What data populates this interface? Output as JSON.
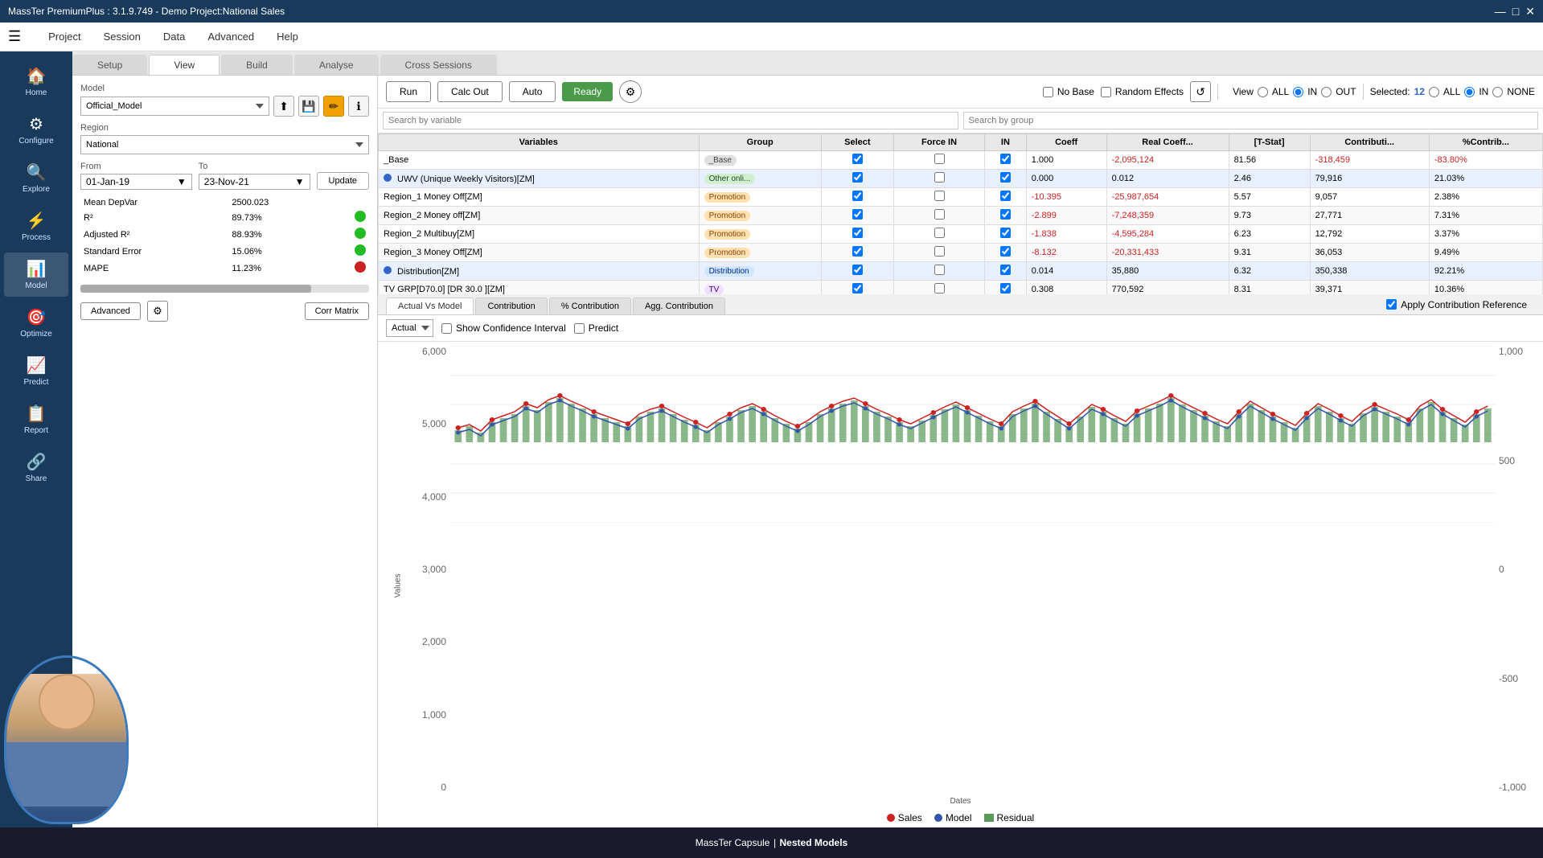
{
  "titlebar": {
    "title": "MassTer PremiumPlus : 3.1.9.749 - Demo Project:National Sales",
    "minimize": "—",
    "maximize": "□",
    "close": "✕"
  },
  "menubar": {
    "items": [
      "Project",
      "Session",
      "Data",
      "Advanced",
      "Help"
    ]
  },
  "tabs": {
    "items": [
      "Setup",
      "View",
      "Build",
      "Analyse",
      "Cross Sessions"
    ]
  },
  "sidebar": {
    "items": [
      {
        "label": "Home",
        "icon": "🏠"
      },
      {
        "label": "Configure",
        "icon": "⚙"
      },
      {
        "label": "Explore",
        "icon": "🔍"
      },
      {
        "label": "Process",
        "icon": "⚡"
      },
      {
        "label": "Model",
        "icon": "📊"
      },
      {
        "label": "Optimize",
        "icon": "🎯"
      },
      {
        "label": "Predict",
        "icon": "📈"
      },
      {
        "label": "Report",
        "icon": "📋"
      },
      {
        "label": "Share",
        "icon": "🔗"
      }
    ]
  },
  "left_panel": {
    "model_label": "Model",
    "model_value": "Official_Model",
    "region_label": "Region",
    "region_value": "National",
    "from_label": "From",
    "to_label": "To",
    "from_value": "01-Jan-19",
    "to_value": "23-Nov-21",
    "update_btn": "Update",
    "stats": [
      {
        "label": "Mean DepVar",
        "value": "2500.023",
        "indicator": null
      },
      {
        "label": "R²",
        "value": "89.73%",
        "indicator": "green"
      },
      {
        "label": "Adjusted R²",
        "value": "88.93%",
        "indicator": "green"
      },
      {
        "label": "Standard Error",
        "value": "15.06%",
        "indicator": "green"
      },
      {
        "label": "MAPE",
        "value": "11.23%",
        "indicator": "red"
      }
    ],
    "advanced_btn": "Advanced",
    "corr_btn": "Corr Matrix"
  },
  "model_controls": {
    "run_btn": "Run",
    "calc_out_btn": "Calc Out",
    "auto_btn": "Auto",
    "ready_btn": "Ready",
    "no_base_label": "No Base",
    "random_effects_label": "Random Effects",
    "view_label": "View",
    "all_label1": "ALL",
    "in_label1": "IN",
    "out_label": "OUT",
    "selected_label": "Selected:",
    "selected_count": "12",
    "all_label2": "ALL",
    "in_label2": "IN",
    "none_label": "NONE"
  },
  "search": {
    "by_variable": "Search by variable",
    "by_group": "Search by group"
  },
  "variables_table": {
    "headers": [
      "Variables",
      "Group",
      "Select",
      "Force IN",
      "IN",
      "Coeff",
      "Real Coeff...",
      "[T-Stat]",
      "Contributi...",
      "%Contrib..."
    ],
    "rows": [
      {
        "indicator": null,
        "name": "_Base",
        "group": "_Base",
        "group_type": "base",
        "select": true,
        "force_in": false,
        "in": true,
        "coeff": "1.000",
        "real_coeff": "-2,095,124",
        "t_stat": "81.56",
        "contrib": "-318,459",
        "pct_contrib": "-83.80%",
        "neg": false
      },
      {
        "indicator": "blue",
        "name": "UWV (Unique Weekly Visitors)[ZM]",
        "group": "Other onli...",
        "group_type": "online",
        "select": true,
        "force_in": false,
        "in": true,
        "coeff": "0.000",
        "real_coeff": "0.012",
        "t_stat": "2.46",
        "contrib": "79,916",
        "pct_contrib": "21.03%",
        "neg": false
      },
      {
        "indicator": null,
        "name": "Region_1 Money Off[ZM]",
        "group": "Promotion",
        "group_type": "promotion",
        "select": true,
        "force_in": false,
        "in": true,
        "coeff": "-10.395",
        "real_coeff": "-25,987,654",
        "t_stat": "5.57",
        "contrib": "9,057",
        "pct_contrib": "2.38%",
        "neg": true
      },
      {
        "indicator": null,
        "name": "Region_2 Money off[ZM]",
        "group": "Promotion",
        "group_type": "promotion",
        "select": true,
        "force_in": false,
        "in": true,
        "coeff": "-2.899",
        "real_coeff": "-7,248,359",
        "t_stat": "9.73",
        "contrib": "27,771",
        "pct_contrib": "7.31%",
        "neg": true
      },
      {
        "indicator": null,
        "name": "Region_2 Multibuy[ZM]",
        "group": "Promotion",
        "group_type": "promotion",
        "select": true,
        "force_in": false,
        "in": true,
        "coeff": "-1.838",
        "real_coeff": "-4,595,284",
        "t_stat": "6.23",
        "contrib": "12,792",
        "pct_contrib": "3.37%",
        "neg": true
      },
      {
        "indicator": null,
        "name": "Region_3 Money Off[ZM]",
        "group": "Promotion",
        "group_type": "promotion",
        "select": true,
        "force_in": false,
        "in": true,
        "coeff": "-8.132",
        "real_coeff": "-20,331,433",
        "t_stat": "9.31",
        "contrib": "36,053",
        "pct_contrib": "9.49%",
        "neg": true
      },
      {
        "indicator": "blue",
        "name": "Distribution[ZM]",
        "group": "Distribution",
        "group_type": "distribution",
        "select": true,
        "force_in": false,
        "in": true,
        "coeff": "0.014",
        "real_coeff": "35,880",
        "t_stat": "6.32",
        "contrib": "350,338",
        "pct_contrib": "92.21%",
        "neg": false
      },
      {
        "indicator": null,
        "name": "TV GRP[D70.0] [DR 30.0 ][ZM]",
        "group": "TV",
        "group_type": "tv",
        "select": true,
        "force_in": false,
        "in": true,
        "coeff": "0.308",
        "real_coeff": "770,592",
        "t_stat": "8.31",
        "contrib": "39,371",
        "pct_contrib": "10.36%",
        "neg": false
      }
    ]
  },
  "chart_tabs": [
    "Actual Vs Model",
    "Contribution",
    "% Contribution",
    "Agg. Contribution"
  ],
  "chart_controls": {
    "dropdown_label": "Actual",
    "show_confidence": "Show Confidence Interval",
    "apply_contrib_ref": "Apply Contribution Reference",
    "predict_label": "Predict"
  },
  "chart": {
    "y_axis_label": "Values",
    "x_axis_label": "Dates",
    "y_left_values": [
      "6,000",
      "5,000",
      "4,000",
      "3,000",
      "2,000",
      "1,000",
      "0"
    ],
    "y_right_values": [
      "1,000",
      "500",
      "0",
      "-500",
      "-1,000"
    ],
    "legend": [
      {
        "label": "Sales",
        "color": "#cc2222",
        "type": "dot"
      },
      {
        "label": "Model",
        "color": "#3355aa",
        "type": "dot"
      },
      {
        "label": "Residual",
        "color": "#448844",
        "type": "square"
      }
    ]
  },
  "bottom_bar": {
    "prefix": "MassTer Capsule",
    "separator": "|",
    "title": "Nested Models"
  }
}
